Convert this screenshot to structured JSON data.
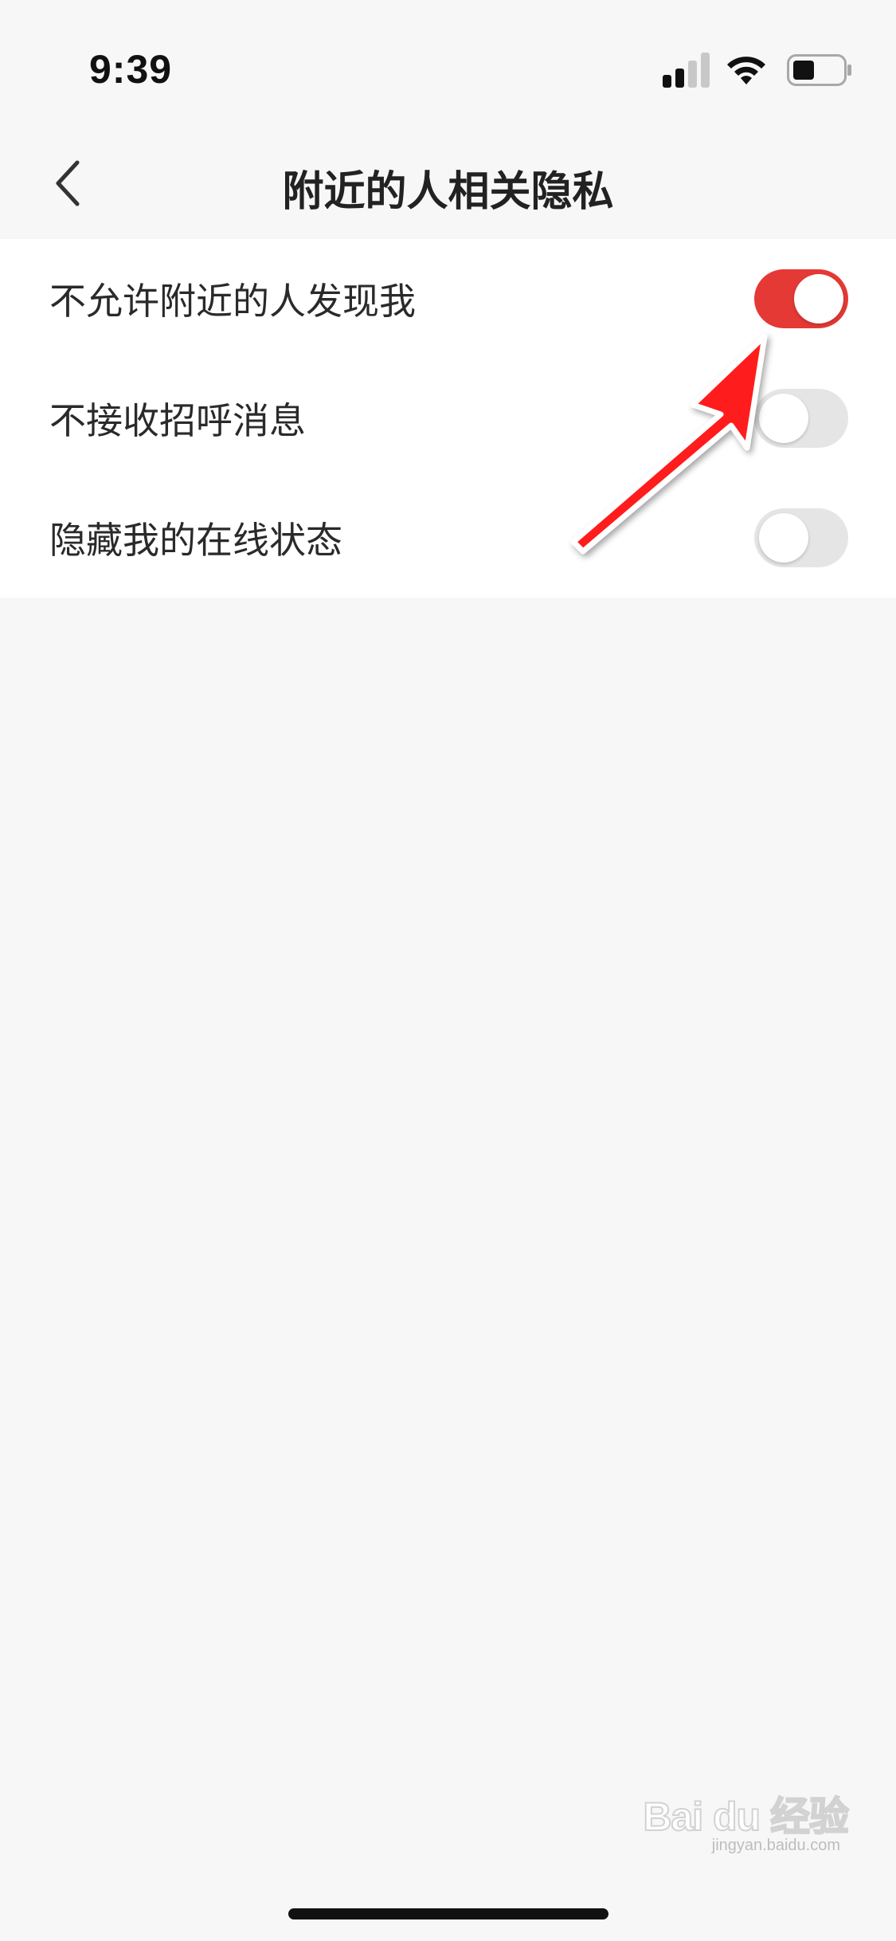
{
  "status_bar": {
    "time": "9:39",
    "icons": [
      "signal-icon",
      "wifi-icon",
      "battery-icon"
    ]
  },
  "nav": {
    "back_icon": "chevron-left-icon",
    "title": "附近的人相关隐私"
  },
  "settings": [
    {
      "label": "不允许附近的人发现我",
      "enabled": true
    },
    {
      "label": "不接收招呼消息",
      "enabled": false
    },
    {
      "label": "隐藏我的在线状态",
      "enabled": false
    }
  ],
  "colors": {
    "toggle_on": "#e53935",
    "toggle_off": "#e5e5e5",
    "background": "#f7f7f7",
    "arrow": "#ff1a1a"
  },
  "watermark": {
    "logo": "Bai du 经验",
    "sub": "jingyan.baidu.com"
  }
}
